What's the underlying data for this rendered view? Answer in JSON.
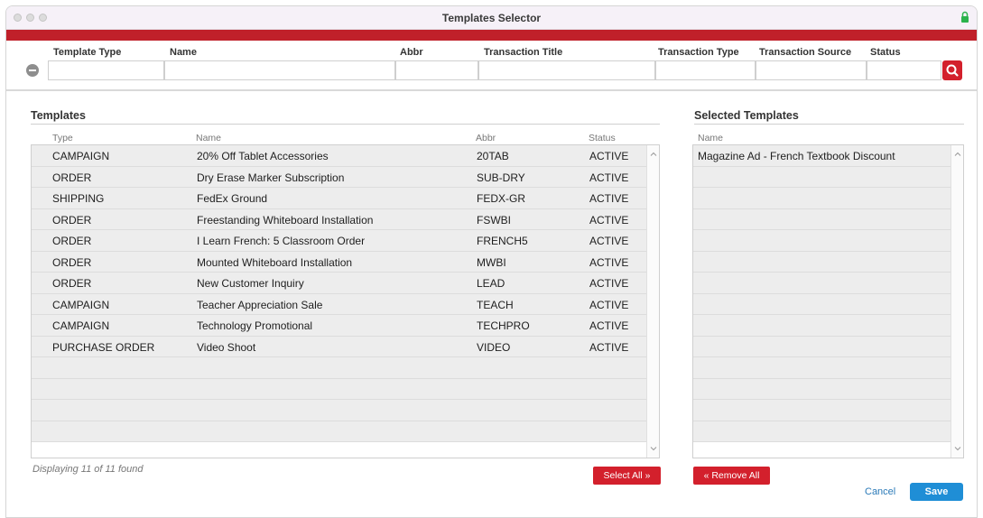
{
  "window": {
    "title": "Templates Selector"
  },
  "filters": {
    "labels": {
      "template_type": "Template Type",
      "name": "Name",
      "abbr": "Abbr",
      "transaction_title": "Transaction Title",
      "transaction_type": "Transaction Type",
      "transaction_source": "Transaction Source",
      "status": "Status"
    },
    "values": {
      "template_type": "",
      "name": "",
      "abbr": "",
      "transaction_title": "",
      "transaction_type": "",
      "transaction_source": "",
      "status": ""
    }
  },
  "templates": {
    "title": "Templates",
    "columns": [
      "Type",
      "Name",
      "Abbr",
      "Status"
    ],
    "rows": [
      {
        "type": "CAMPAIGN",
        "name": "20% Off Tablet Accessories",
        "abbr": "20TAB",
        "status": "ACTIVE"
      },
      {
        "type": "ORDER",
        "name": "Dry Erase Marker Subscription",
        "abbr": "SUB-DRY",
        "status": "ACTIVE"
      },
      {
        "type": "SHIPPING",
        "name": "FedEx Ground",
        "abbr": "FEDX-GR",
        "status": "ACTIVE"
      },
      {
        "type": "ORDER",
        "name": "Freestanding Whiteboard Installation",
        "abbr": "FSWBI",
        "status": "ACTIVE"
      },
      {
        "type": "ORDER",
        "name": "I Learn French: 5 Classroom Order",
        "abbr": "FRENCH5",
        "status": "ACTIVE"
      },
      {
        "type": "ORDER",
        "name": "Mounted Whiteboard Installation",
        "abbr": "MWBI",
        "status": "ACTIVE"
      },
      {
        "type": "ORDER",
        "name": "New Customer Inquiry",
        "abbr": "LEAD",
        "status": "ACTIVE"
      },
      {
        "type": "CAMPAIGN",
        "name": "Teacher Appreciation Sale",
        "abbr": "TEACH",
        "status": "ACTIVE"
      },
      {
        "type": "CAMPAIGN",
        "name": "Technology Promotional",
        "abbr": "TECHPRO",
        "status": "ACTIVE"
      },
      {
        "type": "PURCHASE ORDER",
        "name": "Video Shoot",
        "abbr": "VIDEO",
        "status": "ACTIVE"
      }
    ],
    "footer": "Displaying 11 of 11 found",
    "select_all": "Select All »"
  },
  "selected": {
    "title": "Selected Templates",
    "columns": [
      "Name"
    ],
    "rows": [
      {
        "name": "Magazine Ad - French Textbook Discount"
      }
    ],
    "remove_all": "« Remove All"
  },
  "actions": {
    "cancel": "Cancel",
    "save": "Save"
  },
  "colors": {
    "accent_red": "#c0202a",
    "button_red": "#d3202c",
    "save_blue": "#1f8ed6",
    "link_blue": "#2a7ab8"
  },
  "icons": [
    "lock-icon",
    "minus-circle-icon",
    "search-icon",
    "chevron-up-icon",
    "chevron-down-icon"
  ]
}
